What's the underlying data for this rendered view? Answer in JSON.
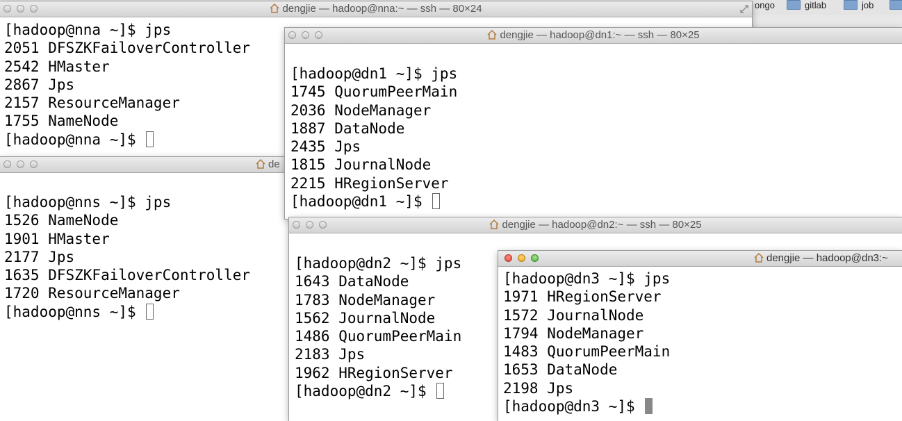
{
  "bookmarks": [
    "ongo",
    "gitlab",
    "job"
  ],
  "windows": {
    "nna": {
      "title": "dengjie — hadoop@nna:~ — ssh — 80×24",
      "lines": [
        "[hadoop@nna ~]$ jps",
        "2051 DFSZKFailoverController",
        "2542 HMaster",
        "2867 Jps",
        "2157 ResourceManager",
        "1755 NameNode"
      ],
      "prompt": "[hadoop@nna ~]$ "
    },
    "nns": {
      "title": "de",
      "lines": [
        "[hadoop@nns ~]$ jps",
        "1526 NameNode",
        "1901 HMaster",
        "2177 Jps",
        "1635 DFSZKFailoverController",
        "1720 ResourceManager"
      ],
      "prompt": "[hadoop@nns ~]$ "
    },
    "dn1": {
      "title": "dengjie — hadoop@dn1:~ — ssh — 80×25",
      "lines": [
        "[hadoop@dn1 ~]$ jps",
        "1745 QuorumPeerMain",
        "2036 NodeManager",
        "1887 DataNode",
        "2435 Jps",
        "1815 JournalNode",
        "2215 HRegionServer"
      ],
      "prompt": "[hadoop@dn1 ~]$ "
    },
    "dn2": {
      "title": "dengjie — hadoop@dn2:~ — ssh — 80×25",
      "lines": [
        "[hadoop@dn2 ~]$ jps",
        "1643 DataNode",
        "1783 NodeManager",
        "1562 JournalNode",
        "1486 QuorumPeerMain",
        "2183 Jps",
        "1962 HRegionServer"
      ],
      "prompt": "[hadoop@dn2 ~]$ "
    },
    "dn3": {
      "title": "dengjie — hadoop@dn3:~",
      "lines": [
        "[hadoop@dn3 ~]$ jps",
        "1971 HRegionServer",
        "1572 JournalNode",
        "1794 NodeManager",
        "1483 QuorumPeerMain",
        "1653 DataNode",
        "2198 Jps"
      ],
      "prompt": "[hadoop@dn3 ~]$ "
    }
  }
}
